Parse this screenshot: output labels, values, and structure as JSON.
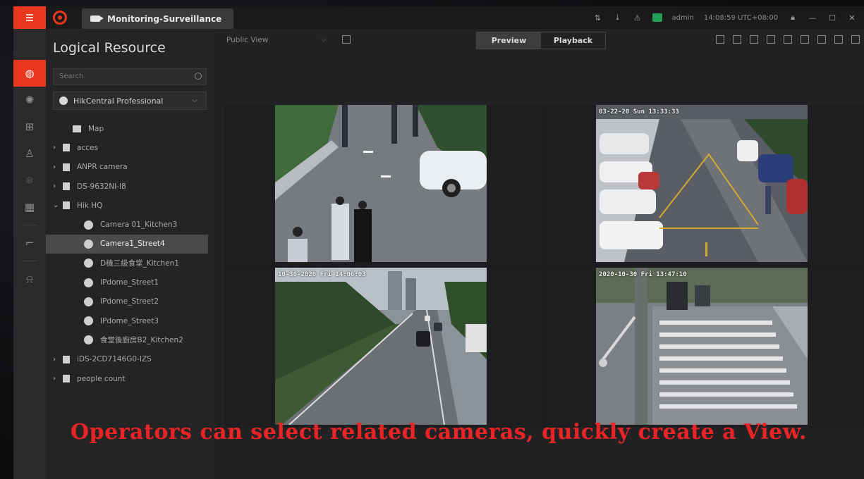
{
  "titlebar": {
    "tab_title": "Monitoring-Surveillance",
    "user": "admin",
    "datetime": "14:08:59 UTC+08:00",
    "icons": [
      "sync-icon",
      "download-icon",
      "alarm-icon",
      "status-icon",
      "lock-icon",
      "minimize-icon",
      "maximize-icon",
      "close-icon"
    ]
  },
  "rail": {
    "items": [
      "globe-icon",
      "radar-icon",
      "grid-icon",
      "person-icon",
      "face-icon",
      "table-icon",
      "camera-icon",
      "alarm-bell-icon"
    ],
    "active_index": 0
  },
  "panel": {
    "title": "Logical Resource",
    "search_placeholder": "Search",
    "site": "HikCentral Professional",
    "tree": [
      {
        "label": "Map",
        "kind": "map"
      },
      {
        "label": "acces",
        "kind": "area",
        "expanded": false
      },
      {
        "label": "ANPR camera",
        "kind": "area",
        "expanded": false
      },
      {
        "label": "DS-9632NI-I8",
        "kind": "area",
        "expanded": false
      },
      {
        "label": "Hik HQ",
        "kind": "area",
        "expanded": true
      },
      {
        "label": "Camera 01_Kitchen3",
        "kind": "camera"
      },
      {
        "label": "Camera1_Street4",
        "kind": "camera",
        "selected": true
      },
      {
        "label": "D機三級食堂_Kitchen1",
        "kind": "camera"
      },
      {
        "label": "IPdome_Street1",
        "kind": "camera"
      },
      {
        "label": "IPdome_Street2",
        "kind": "camera"
      },
      {
        "label": "IPdome_Street3",
        "kind": "camera"
      },
      {
        "label": "食堂後廚房B2_Kitchen2",
        "kind": "camera"
      },
      {
        "label": "iDS-2CD7146G0-IZS",
        "kind": "area",
        "expanded": false
      },
      {
        "label": "people count",
        "kind": "area",
        "expanded": false
      }
    ]
  },
  "toolbar": {
    "view_label": "Public View",
    "preview_label": "Preview",
    "playback_label": "Playback",
    "active_mode": "Preview"
  },
  "grid": {
    "cells": [
      {
        "camera": "Camera1_Street4",
        "osd": ""
      },
      {
        "camera": "IPdome_Street1",
        "osd": "03-22-20 Sun 13:33:33"
      },
      {
        "camera": "IPdome_Street2",
        "osd": "10-30-2020 Fri 14:06:03"
      },
      {
        "camera": "IPdome_Street3",
        "osd": "2020-10-30 Fri 13:47:10"
      }
    ]
  },
  "caption": "Operators can select related cameras, quickly create a View.",
  "colors": {
    "accent": "#e8371d",
    "caption": "#e82424",
    "background": "#242426"
  }
}
